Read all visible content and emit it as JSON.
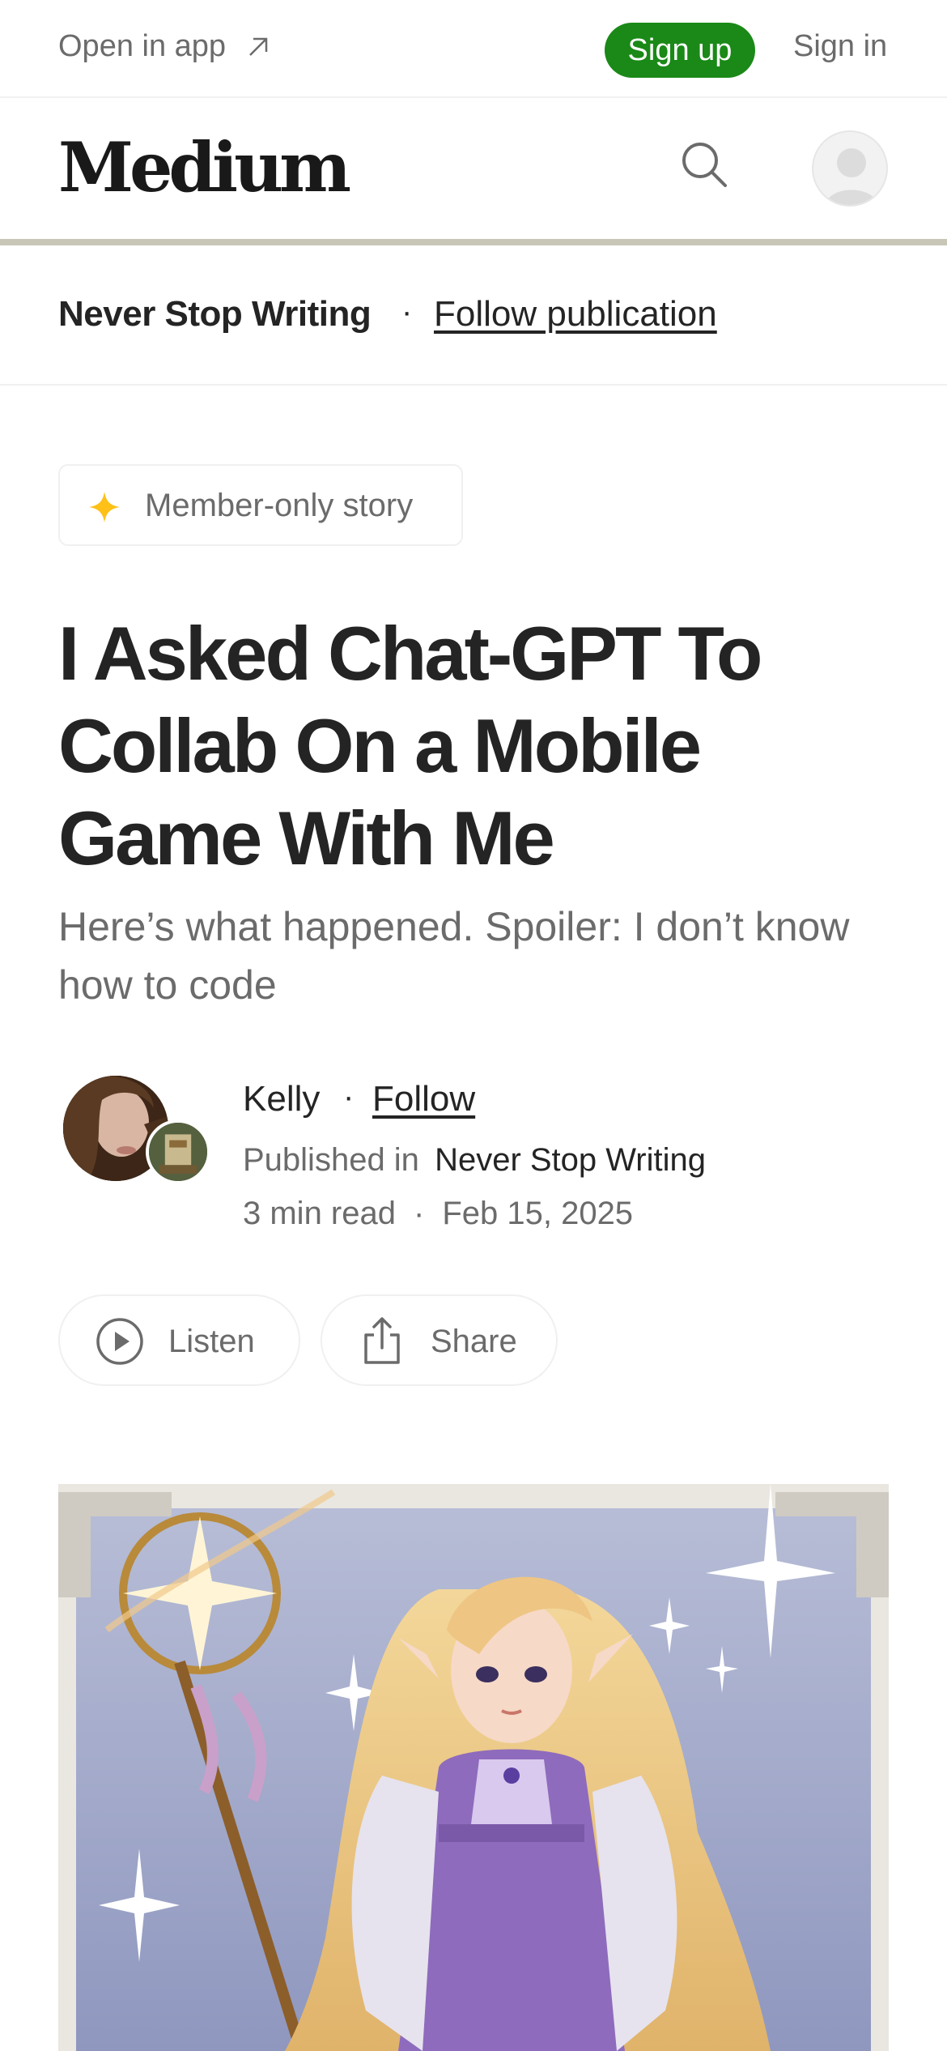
{
  "topbar": {
    "open_in_app": "Open in app",
    "sign_up": "Sign up",
    "sign_in": "Sign in"
  },
  "header": {
    "logo": "Medium"
  },
  "publication_bar": {
    "name": "Never Stop Writing",
    "separator": "·",
    "follow": "Follow publication"
  },
  "member_badge": {
    "label": "Member-only story"
  },
  "article": {
    "title": "I Asked Chat-GPT To Collab On a Mobile Game With Me",
    "subtitle": "Here’s what happened. Spoiler: I don’t know how to code"
  },
  "author": {
    "name": "Kelly",
    "separator": "·",
    "follow": "Follow",
    "published_in_label": "Published in",
    "publication": "Never Stop Writing",
    "read_time": "3 min read",
    "meta_separator": "·",
    "date": "Feb 15, 2025"
  },
  "actions": {
    "listen": "Listen",
    "share": "Share"
  },
  "colors": {
    "accent_green": "#1a8917",
    "text_primary": "#242424",
    "text_secondary": "#6b6b6b",
    "star": "#ffc017"
  },
  "icons": [
    "arrow-up-right-icon",
    "search-icon",
    "user-avatar-icon",
    "sparkle-star-icon",
    "play-circle-icon",
    "share-icon"
  ]
}
